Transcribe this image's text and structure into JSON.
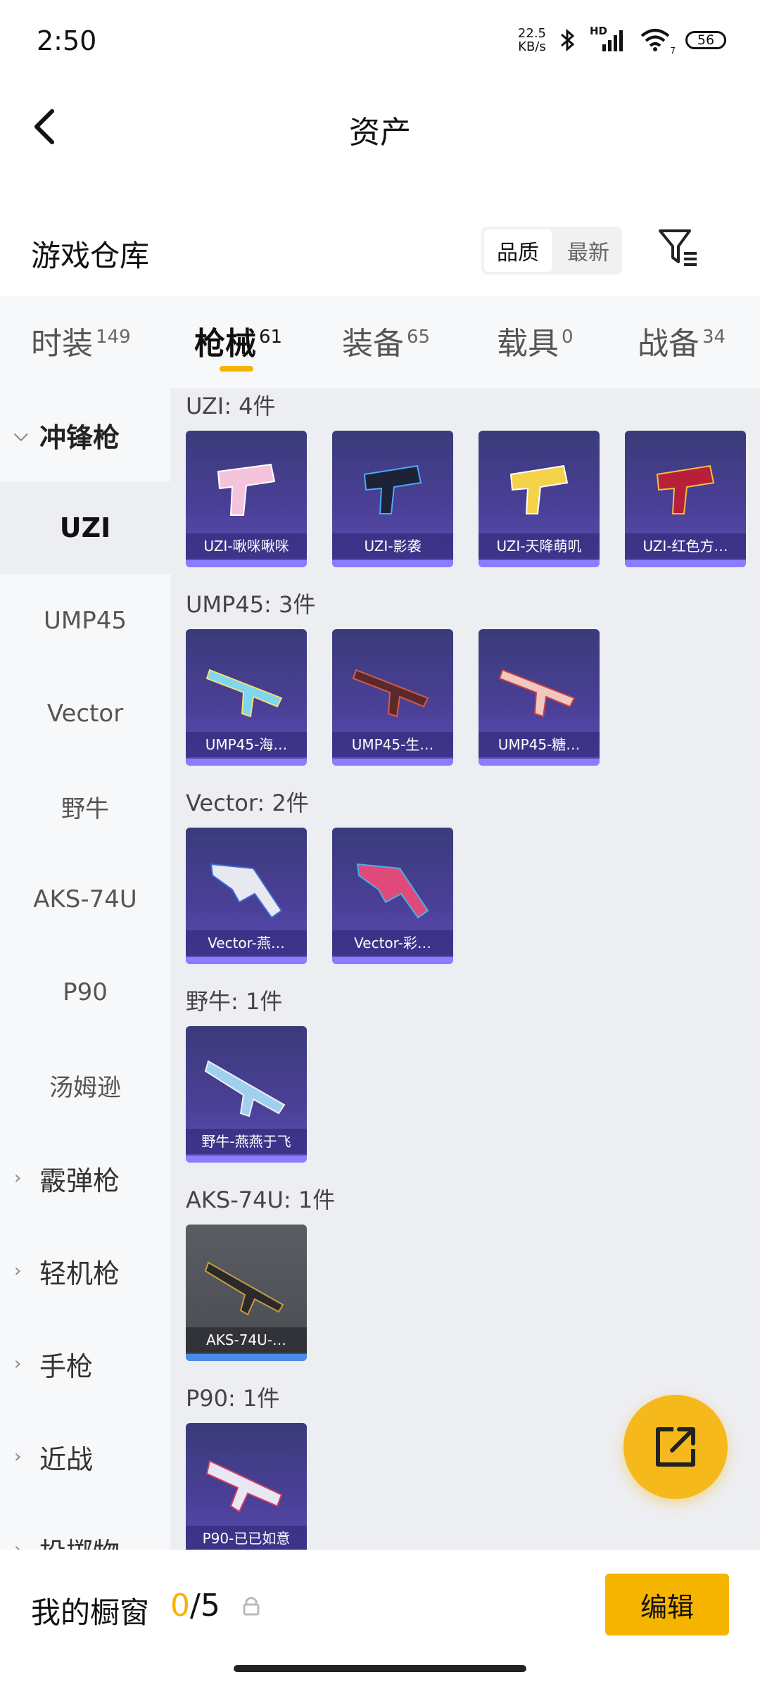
{
  "status": {
    "time": "2:50",
    "speed_value": "22.5",
    "speed_unit": "KB/s",
    "network": "HD",
    "wifi_sub": "7",
    "battery": "56"
  },
  "header": {
    "title": "资产"
  },
  "warehouse": {
    "title": "游戏仓库",
    "sort_quality": "品质",
    "sort_newest": "最新"
  },
  "tabs": [
    {
      "label": "时装",
      "count": "149"
    },
    {
      "label": "枪械",
      "count": "61"
    },
    {
      "label": "装备",
      "count": "65"
    },
    {
      "label": "载具",
      "count": "0"
    },
    {
      "label": "战备",
      "count": "34"
    }
  ],
  "sidebar": [
    {
      "label": "冲锋枪"
    },
    {
      "label": "UZI"
    },
    {
      "label": "UMP45"
    },
    {
      "label": "Vector"
    },
    {
      "label": "野牛"
    },
    {
      "label": "AKS-74U"
    },
    {
      "label": "P90"
    },
    {
      "label": "汤姆逊"
    },
    {
      "label": "霰弹枪"
    },
    {
      "label": "轻机枪"
    },
    {
      "label": "手枪"
    },
    {
      "label": "近战"
    },
    {
      "label": "投掷物"
    }
  ],
  "groups": [
    {
      "title": "UZI: 4件",
      "items": [
        "UZI-啾咪啾咪",
        "UZI-影袭",
        "UZI-天降萌叽",
        "UZI-红色方…"
      ]
    },
    {
      "title": "UMP45: 3件",
      "items": [
        "UMP45-海…",
        "UMP45-生…",
        "UMP45-糖…"
      ]
    },
    {
      "title": "Vector: 2件",
      "items": [
        "Vector-燕…",
        "Vector-彩…"
      ]
    },
    {
      "title": "野牛: 1件",
      "items": [
        "野牛-燕燕于飞"
      ]
    },
    {
      "title": "AKS-74U: 1件",
      "items": [
        "AKS-74U-…"
      ]
    },
    {
      "title": "P90: 1件",
      "items": [
        "P90-已已如意"
      ]
    }
  ],
  "bottom": {
    "label": "我的橱窗",
    "count": "0",
    "total": "/5",
    "edit": "编辑"
  },
  "colors": {
    "accent": "#f5b400",
    "card_purple": "#4a3f96",
    "card_grey": "#4a4c52"
  }
}
